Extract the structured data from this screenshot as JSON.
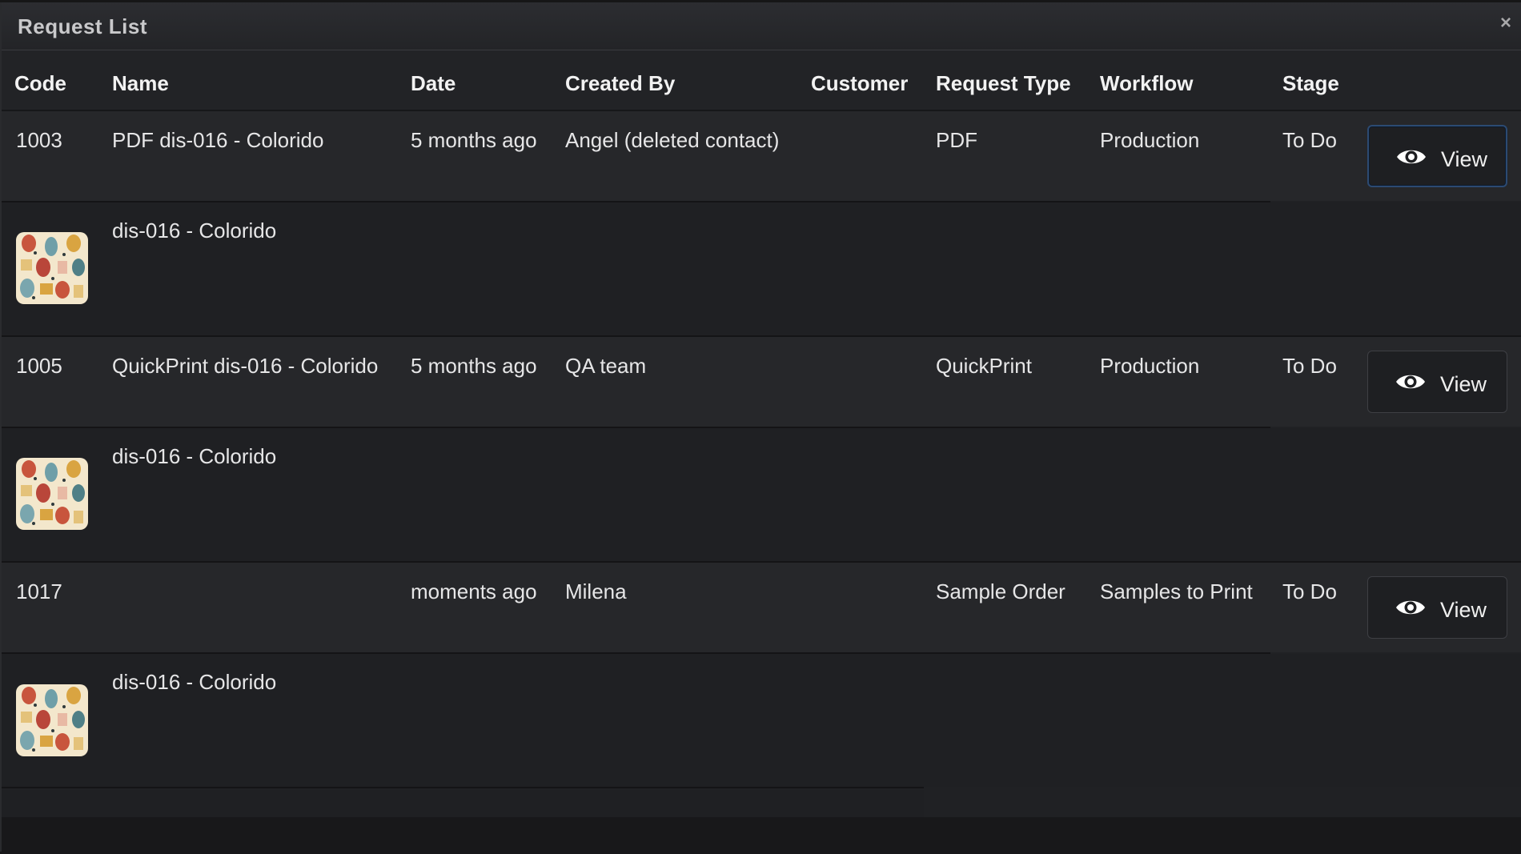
{
  "dialog": {
    "title": "Request List",
    "close_label": "×"
  },
  "table": {
    "columns": [
      "Code",
      "Name",
      "Date",
      "Created By",
      "Customer",
      "Request Type",
      "Workflow",
      "Stage"
    ],
    "rows": [
      {
        "code": "1003",
        "name": "PDF dis-016 - Colorido",
        "date": "5 months ago",
        "created_by": "Angel (deleted contact)",
        "customer": "",
        "request_type": "PDF",
        "workflow": "Production",
        "stage": "To Do",
        "view_label": "View",
        "attachment_name": "dis-016 - Colorido"
      },
      {
        "code": "1005",
        "name": "QuickPrint dis-016 - Colorido",
        "date": "5 months ago",
        "created_by": "QA team",
        "customer": "",
        "request_type": "QuickPrint",
        "workflow": "Production",
        "stage": "To Do",
        "view_label": "View",
        "attachment_name": "dis-016 - Colorido"
      },
      {
        "code": "1017",
        "name": "",
        "date": "moments ago",
        "created_by": "Milena",
        "customer": "",
        "request_type": "Sample Order",
        "workflow": "Samples to Print",
        "stage": "To Do",
        "view_label": "View",
        "attachment_name": "dis-016 - Colorido"
      }
    ]
  },
  "icons": {
    "view": "eye-icon",
    "close": "close-icon",
    "thumbnail": "pattern-thumbnail"
  },
  "colors": {
    "background": "#202124",
    "header_text": "#f2f2f2",
    "focus_border": "#2c4a72"
  }
}
